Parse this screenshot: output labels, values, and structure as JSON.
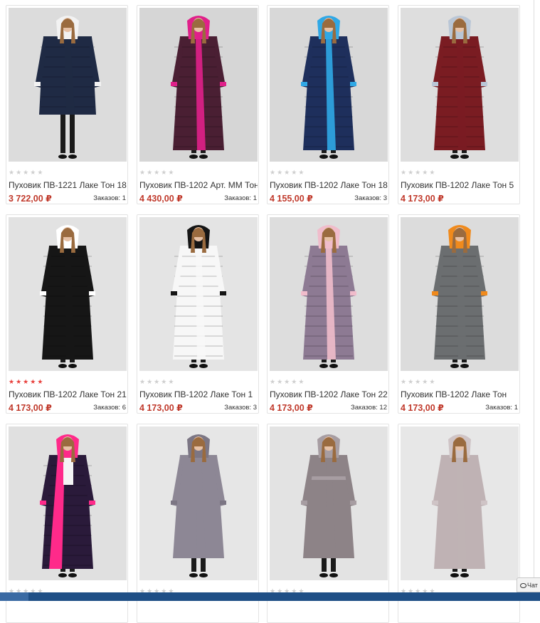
{
  "products": [
    {
      "name": "Пуховик ПВ-1221 Лаке Тон 18",
      "price": "3 722,00 ₽",
      "orders": "Заказов: 1",
      "rating": 0,
      "coat": "#1f2a44",
      "trim": "#f2f2f2",
      "lining": "#1f2a44",
      "bg": "#dcdcdc",
      "style": "short"
    },
    {
      "name": "Пуховик ПВ-1202 Арт. ММ Тон",
      "price": "4 430,00 ₽",
      "orders": "Заказов: 1",
      "rating": 0,
      "coat": "#4a1f33",
      "trim": "#e0208a",
      "lining": "#e0208a",
      "bg": "#d6d6d6",
      "style": "long"
    },
    {
      "name": "Пуховик ПВ-1202 Лаке Тон 18",
      "price": "4 155,00 ₽",
      "orders": "Заказов: 3",
      "rating": 0,
      "coat": "#1e2f5c",
      "trim": "#2fa8e6",
      "lining": "#2fa8e6",
      "bg": "#d8d8d8",
      "style": "long"
    },
    {
      "name": "Пуховик ПВ-1202 Лаке Тон 5",
      "price": "4 173,00 ₽",
      "orders": "",
      "rating": 0,
      "coat": "#7a1c22",
      "trim": "#b9c6d6",
      "lining": "#7a1c22",
      "bg": "#dedede",
      "style": "long"
    },
    {
      "name": "Пуховик ПВ-1202 Лаке Тон 21",
      "price": "4 173,00 ₽",
      "orders": "Заказов: 6",
      "rating": 5,
      "coat": "#161616",
      "trim": "#ffffff",
      "lining": "#161616",
      "bg": "#e2e2e2",
      "style": "long"
    },
    {
      "name": "Пуховик ПВ-1202 Лаке Тон 1",
      "price": "4 173,00 ₽",
      "orders": "Заказов: 3",
      "rating": 0,
      "coat": "#f7f7f7",
      "trim": "#151515",
      "lining": "#f7f7f7",
      "bg": "#e4e4e4",
      "style": "long"
    },
    {
      "name": "Пуховик ПВ-1202 Лаке Тон 22",
      "price": "4 173,00 ₽",
      "orders": "Заказов: 12",
      "rating": 0,
      "coat": "#8d7a93",
      "trim": "#f0bccb",
      "lining": "#f0bccb",
      "bg": "#dddddd",
      "style": "long"
    },
    {
      "name": "Пуховик ПВ-1202 Лаке Тон",
      "price": "4 173,00 ₽",
      "orders": "Заказов: 1",
      "rating": 0,
      "coat": "#6b6e70",
      "trim": "#f08a1c",
      "lining": "#6b6e70",
      "bg": "#dcdcdc",
      "style": "long"
    },
    {
      "name": "",
      "price": "",
      "orders": "",
      "rating": 0,
      "coat": "#2a1a3a",
      "trim": "#ff2a8a",
      "lining": "#ff2a8a",
      "bg": "#e0e0e0",
      "style": "open"
    },
    {
      "name": "",
      "price": "",
      "orders": "",
      "rating": 0,
      "coat": "#8d8795",
      "trim": "#7c7684",
      "lining": "#8d8795",
      "bg": "#e6e6e6",
      "style": "coat"
    },
    {
      "name": "",
      "price": "",
      "orders": "",
      "rating": 0,
      "coat": "#8d8387",
      "trim": "#a79da2",
      "lining": "#8d8387",
      "bg": "#e3e3e3",
      "style": "belted"
    },
    {
      "name": "",
      "price": "",
      "orders": "",
      "rating": 0,
      "coat": "#bfb2b4",
      "trim": "#cfc4c6",
      "lining": "#bfb2b4",
      "bg": "#e7e7e7",
      "style": "wrap"
    }
  ],
  "chat": {
    "label": "Чат"
  }
}
